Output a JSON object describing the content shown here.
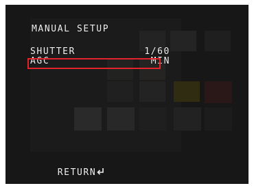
{
  "osd": {
    "title": "MANUAL SETUP",
    "items": [
      {
        "label": "SHUTTER",
        "value": "1/60"
      },
      {
        "label": "AGC",
        "value": "MIN"
      }
    ],
    "selected_index": 1,
    "return_label": "RETURN",
    "return_icon": "return-arrow-icon"
  },
  "colors": {
    "screen_bg": "#161616",
    "text": "#f2f2f2",
    "selection_border": "#e3252b"
  }
}
